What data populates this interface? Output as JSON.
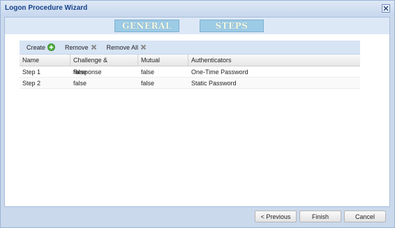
{
  "window": {
    "title": "Logon Procedure Wizard",
    "close_icon": "close-icon"
  },
  "tabs": [
    {
      "label": "GENERAL"
    },
    {
      "label": "STEPS"
    }
  ],
  "toolbar": {
    "create_label": "Create",
    "remove_label": "Remove",
    "remove_all_label": "Remove All",
    "create_icon": "add-circle-icon",
    "remove_icon": "cross-icon",
    "remove_all_icon": "cross-icon"
  },
  "grid": {
    "columns": [
      "Name",
      "Challenge & Response",
      "Mutual",
      "Authenticators"
    ],
    "rows": [
      [
        "Step 1",
        "false",
        "false",
        "One-Time Password"
      ],
      [
        "Step 2",
        "false",
        "false",
        "Static Password"
      ]
    ]
  },
  "footer": {
    "previous_label": "< Previous",
    "finish_label": "Finish",
    "cancel_label": "Cancel"
  },
  "colors": {
    "title_text": "#15428b",
    "tab_bg": "#9ccbe6",
    "add_icon": "#4caf3f",
    "remove_icon": "#8a8a8a"
  }
}
